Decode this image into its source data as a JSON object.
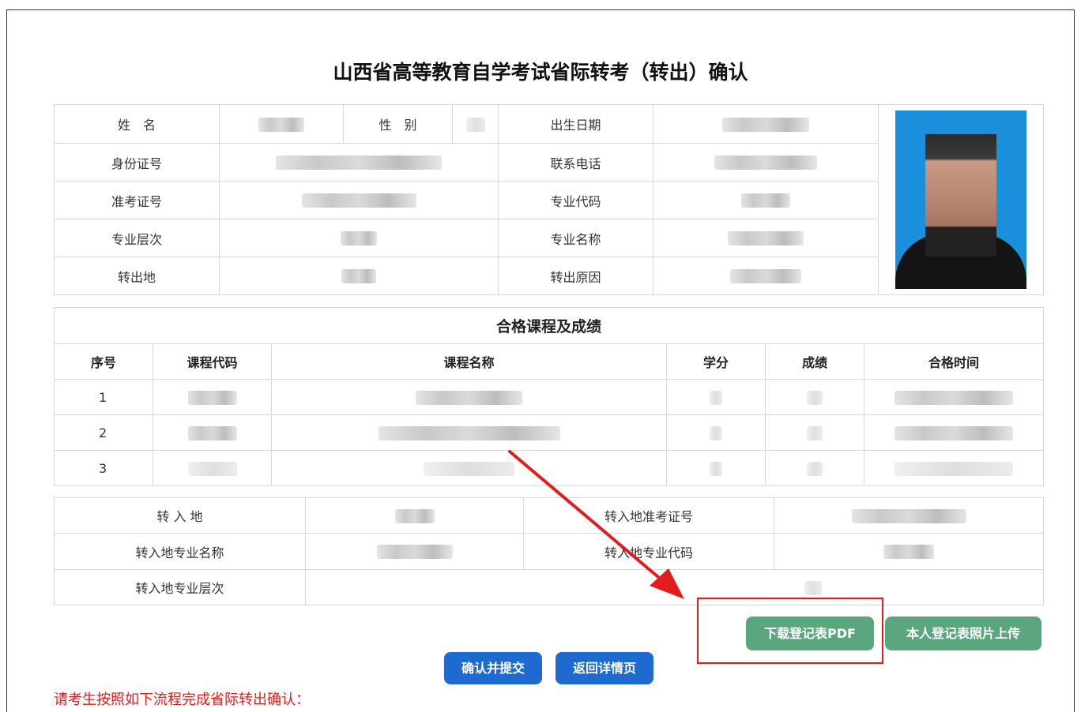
{
  "page_title": "山西省高等教育自学考试省际转考（转出）确认",
  "personal": {
    "name_label": "姓　名",
    "gender_label": "性　别",
    "birth_label": "出生日期",
    "id_label": "身份证号",
    "phone_label": "联系电话",
    "exam_no_label": "准考证号",
    "major_code_label": "专业代码",
    "level_label": "专业层次",
    "major_name_label": "专业名称",
    "out_place_label": "转出地",
    "out_reason_label": "转出原因"
  },
  "courses": {
    "section_title": "合格课程及成绩",
    "headers": [
      "序号",
      "课程代码",
      "课程名称",
      "学分",
      "成绩",
      "合格时间"
    ],
    "rows": [
      "1",
      "2",
      "3"
    ]
  },
  "transfer_in": {
    "place_label": "转 入 地",
    "exam_no_label": "转入地准考证号",
    "major_name_label": "转入地专业名称",
    "major_code_label": "转入地专业代码",
    "level_label": "转入地专业层次"
  },
  "buttons": {
    "download_pdf": "下载登记表PDF",
    "upload_photo": "本人登记表照片上传",
    "confirm_submit": "确认并提交",
    "back_detail": "返回详情页"
  },
  "notice_text": "请考生按照如下流程完成省际转出确认：",
  "colors": {
    "green_button": "#5aa77f",
    "blue_button": "#1f6ad0",
    "highlight_red": "#e21d1d"
  },
  "icons": {
    "annotation": "red-arrow"
  }
}
